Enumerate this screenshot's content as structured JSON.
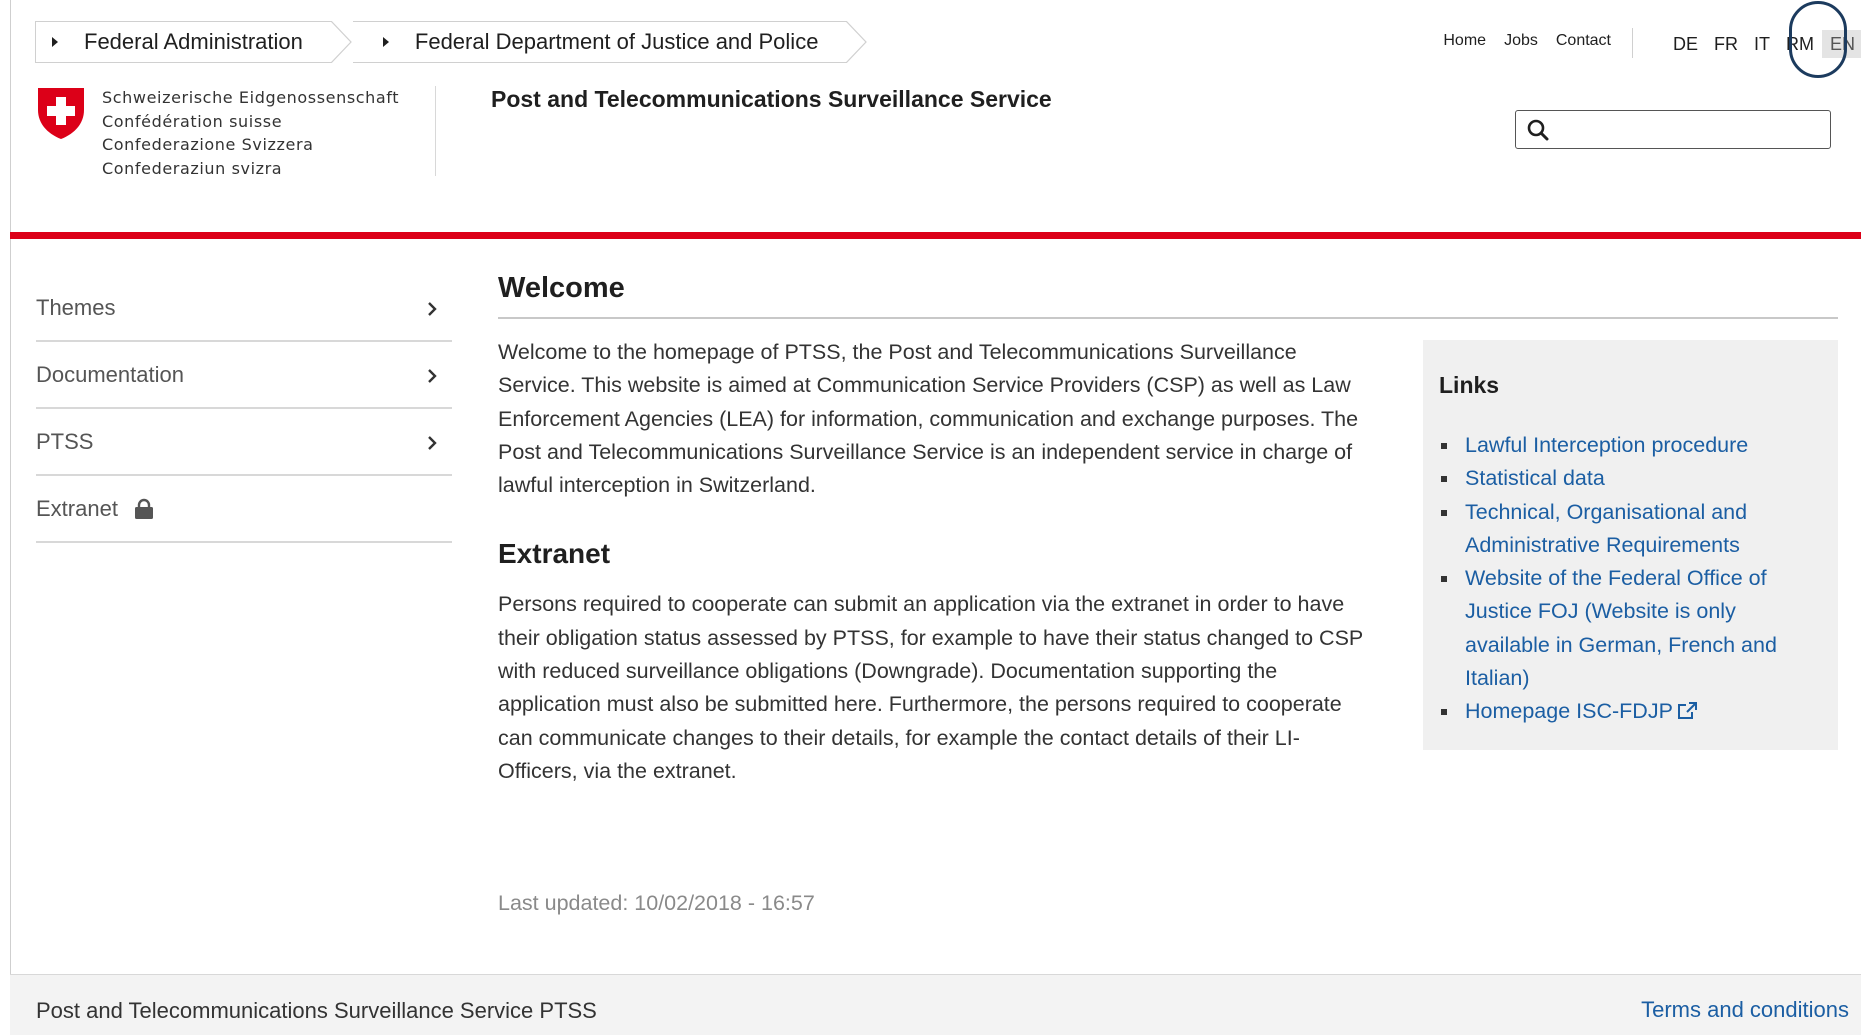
{
  "breadcrumb": {
    "items": [
      "Federal Administration",
      "Federal Department of Justice and Police"
    ]
  },
  "topnav": {
    "home": "Home",
    "jobs": "Jobs",
    "contact": "Contact"
  },
  "languages": {
    "items": [
      "DE",
      "FR",
      "IT",
      "RM",
      "EN"
    ],
    "active": "EN"
  },
  "logo": {
    "lines": [
      "Schweizerische Eidgenossenschaft",
      "Confédération suisse",
      "Confederazione Svizzera",
      "Confederaziun svizra"
    ]
  },
  "site_title": "Post and Telecommunications Surveillance Service",
  "search": {
    "value": "",
    "placeholder": ""
  },
  "sidenav": {
    "items": [
      {
        "label": "Themes",
        "icon": "chevron-right-icon"
      },
      {
        "label": "Documentation",
        "icon": "chevron-right-icon"
      },
      {
        "label": "PTSS",
        "icon": "chevron-right-icon"
      },
      {
        "label": "Extranet",
        "icon": "lock-icon"
      }
    ]
  },
  "main": {
    "welcome_heading": "Welcome",
    "welcome_text": "Welcome to the homepage of PTSS, the Post and Telecommunications Surveillance Service. This website is aimed at Communication Service Providers (CSP) as well as Law Enforcement Agencies (LEA) for information, communication and exchange purposes. The Post and Telecommunications Surveillance Service is an independent service in charge of lawful interception in Switzerland.",
    "extranet_heading": "Extranet",
    "extranet_text": "Persons required to cooperate can submit an application via the extranet in order to have their obligation status assessed by PTSS, for example to have their status changed to CSP with reduced surveillance obligations (Downgrade). Documentation supporting the application must also be submitted here. Furthermore, the persons required to cooperate can communicate changes to their details, for example the contact details of their LI-Officers, via the extranet.",
    "last_updated": "Last updated: 10/02/2018 - 16:57"
  },
  "links": {
    "heading": "Links",
    "items": [
      "Lawful Interception procedure",
      "Statistical data",
      "Technical, Organisational and Administrative Requirements",
      "Website of the Federal Office of Justice FOJ (Website is only available in German, French and Italian)",
      "Homepage ISC-FDJP"
    ]
  },
  "footer": {
    "left": "Post and Telecommunications Surveillance Service PTSS",
    "right": "Terms and conditions"
  },
  "colors": {
    "accent_red": "#dc0018",
    "link_blue": "#1b5ea3",
    "highlight_ring": "#1c3b5e"
  }
}
